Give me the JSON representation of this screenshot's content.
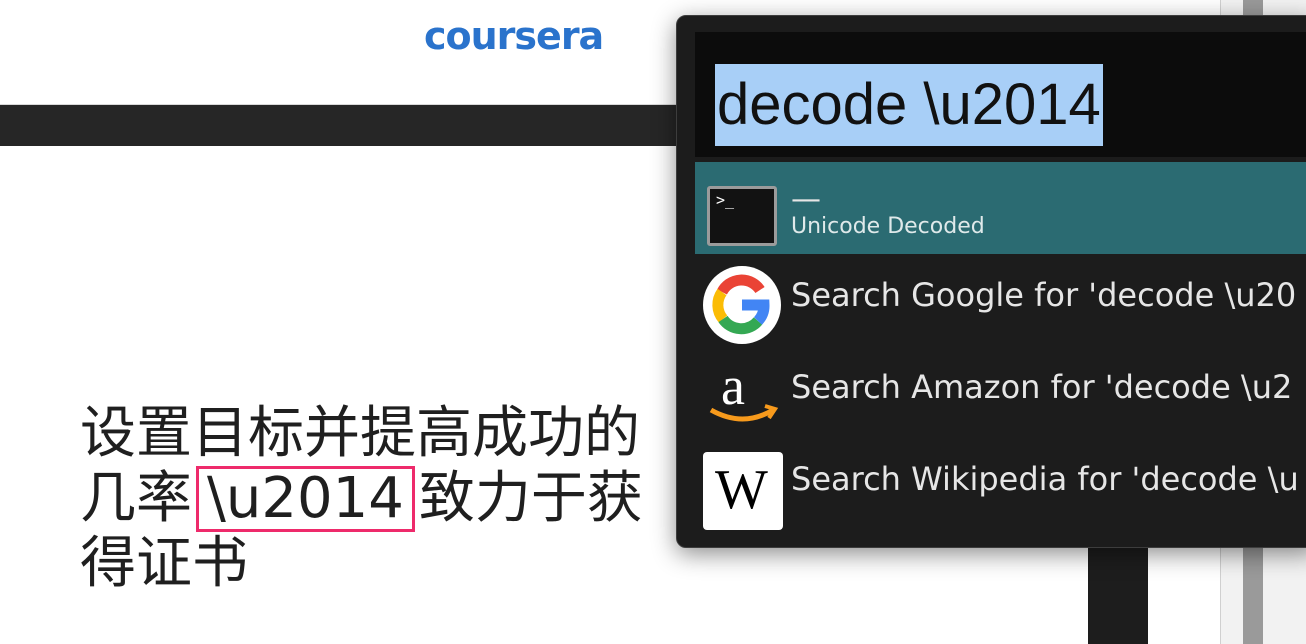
{
  "website": {
    "logo_text": "coursera",
    "headline_before": "设置目标并提高成功的几率",
    "headline_highlight": "\\u2014",
    "headline_after": "致力于获得证书"
  },
  "launcher": {
    "query": "decode \\u2014",
    "results": [
      {
        "title": "—",
        "subtitle": "Unicode Decoded",
        "icon": "terminal-icon",
        "selected": true
      },
      {
        "title": "Search Google for 'decode \\u20",
        "icon": "google-icon",
        "selected": false
      },
      {
        "title": "Search Amazon for 'decode \\u2",
        "icon": "amazon-icon",
        "selected": false
      },
      {
        "title": "Search Wikipedia for 'decode \\u",
        "icon": "wikipedia-icon",
        "selected": false
      }
    ]
  },
  "colors": {
    "coursera_blue": "#2a73cc",
    "highlight_border": "#ee2a6b",
    "selected_row": "#2b6b72",
    "query_selection": "#a8cff7"
  }
}
